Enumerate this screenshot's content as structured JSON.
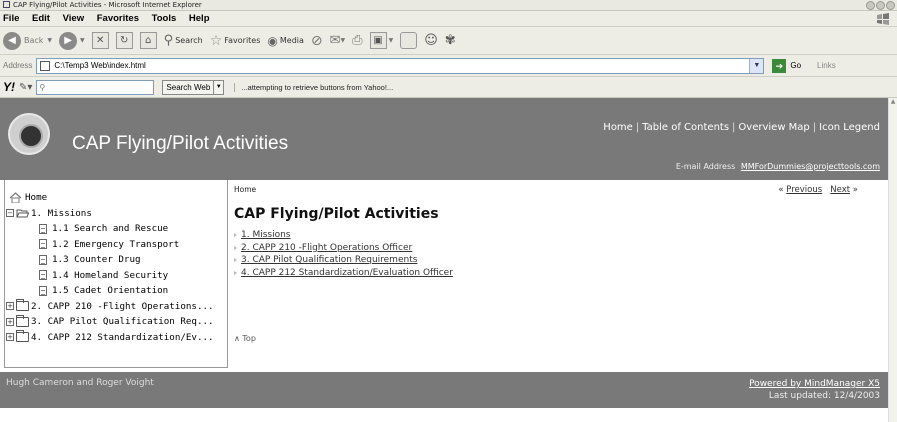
{
  "window": {
    "title": "CAP Flying/Pilot Activities - Microsoft Internet Explorer"
  },
  "menu": [
    "File",
    "Edit",
    "View",
    "Favorites",
    "Tools",
    "Help"
  ],
  "toolbar": {
    "back": "Back",
    "search": "Search",
    "favorites": "Favorites",
    "media": "Media"
  },
  "address": {
    "label": "Address",
    "value": "C:\\Temp3 Web\\index.html",
    "go": "Go",
    "links": "Links"
  },
  "yahoo": {
    "input_value": "",
    "search_button": "Search Web",
    "status": "...attempting to retrieve buttons from Yahoo!..."
  },
  "site": {
    "title": "CAP Flying/Pilot Activities",
    "top_links": [
      "Home",
      "Table of Contents",
      "Overview Map",
      "Icon Legend"
    ],
    "email_label": "E-mail Address",
    "email": "MMForDummies@projecttools.com"
  },
  "tree": [
    {
      "label": "Home",
      "type": "home",
      "level": 0
    },
    {
      "label": "1. Missions",
      "type": "open-folder",
      "level": 0,
      "expander": "−"
    },
    {
      "label": "1.1 Search and Rescue",
      "type": "page",
      "level": 1
    },
    {
      "label": "1.2 Emergency Transport",
      "type": "page",
      "level": 1
    },
    {
      "label": "1.3 Counter Drug",
      "type": "page",
      "level": 1
    },
    {
      "label": "1.4 Homeland Security",
      "type": "page",
      "level": 1
    },
    {
      "label": "1.5 Cadet Orientation",
      "type": "page",
      "level": 1
    },
    {
      "label": "2. CAPP 210 -Flight Operations...",
      "type": "folder",
      "level": 0,
      "expander": "+"
    },
    {
      "label": "3. CAP Pilot Qualification Req...",
      "type": "folder",
      "level": 0,
      "expander": "+"
    },
    {
      "label": "4. CAPP 212 Standardization/Ev...",
      "type": "folder",
      "level": 0,
      "expander": "+"
    }
  ],
  "content": {
    "breadcrumb": "Home",
    "prev": "Previous",
    "next": "Next",
    "prev_glyph": "«",
    "next_glyph": "»",
    "heading": "CAP Flying/Pilot Activities",
    "links": [
      "1. Missions",
      "2. CAPP 210 -Flight Operations Officer",
      "3. CAP Pilot Qualification Requirements",
      "4. CAPP 212 Standardization/Evaluation Officer"
    ],
    "top_glyph": "∧",
    "top": "Top"
  },
  "footer": {
    "authors": "Hugh Cameron and Roger Voight",
    "powered": "Powered by MindManager X5",
    "updated": "Last updated: 12/4/2003"
  }
}
